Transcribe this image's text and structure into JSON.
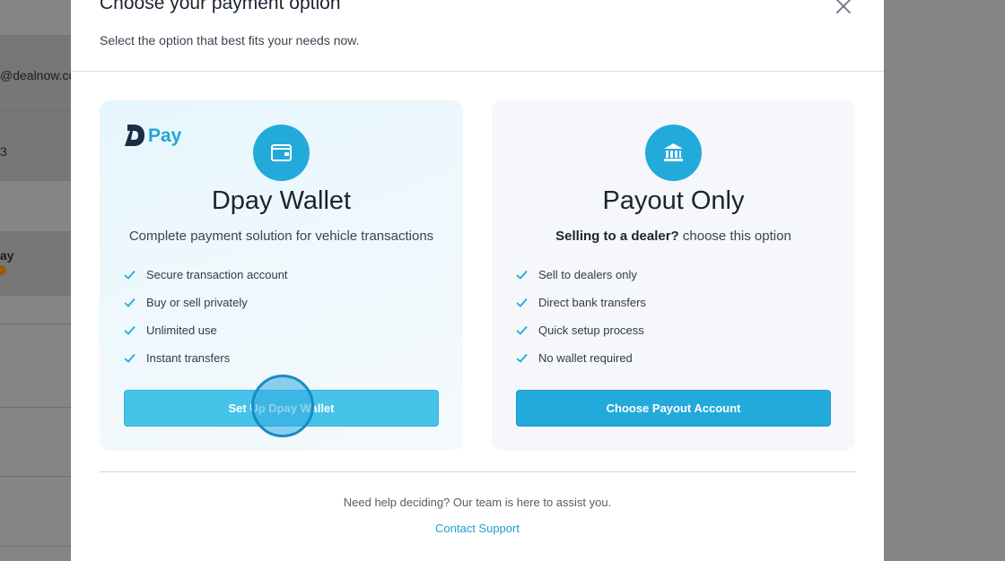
{
  "background": {
    "email_fragment": "@dealnow.co",
    "number_fragment": "3",
    "name_fragment": "ay"
  },
  "modal": {
    "title": "Choose your payment option",
    "subtitle": "Select the option that best fits your needs now.",
    "close_icon": "close-icon"
  },
  "cards": [
    {
      "brand": "Pay",
      "icon": "wallet-icon",
      "title": "Dpay Wallet",
      "description": "Complete payment solution for vehicle transactions",
      "features": [
        "Secure transaction account",
        "Buy or sell privately",
        "Unlimited use",
        "Instant transfers"
      ],
      "button_label": "Set Up Dpay Wallet"
    },
    {
      "icon": "bank-icon",
      "title": "Payout Only",
      "description_bold": "Selling to a dealer?",
      "description_rest": " choose this option",
      "features": [
        "Sell to dealers only",
        "Direct bank transfers",
        "Quick setup process",
        "No wallet required"
      ],
      "button_label": "Choose Payout Account"
    }
  ],
  "footer": {
    "help_text": "Need help deciding? Our team is here to assist you.",
    "link_label": "Contact Support"
  },
  "colors": {
    "accent": "#22aadb",
    "link": "#1f9fcf",
    "text": "#1b2430"
  }
}
